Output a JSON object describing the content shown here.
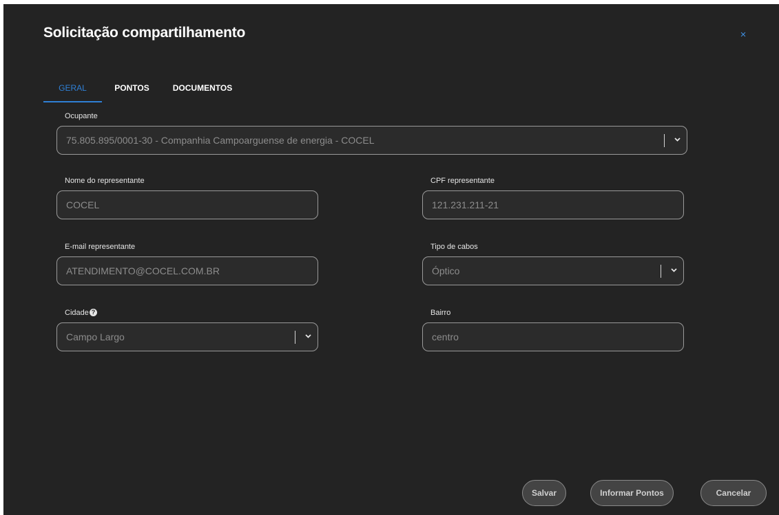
{
  "dialog": {
    "title": "Solicitação compartilhamento",
    "close_label": "×"
  },
  "tabs": [
    {
      "label": "GERAL",
      "active": true
    },
    {
      "label": "PONTOS",
      "active": false
    },
    {
      "label": "DOCUMENTOS",
      "active": false
    }
  ],
  "form": {
    "ocupante": {
      "label": "Ocupante",
      "value": "75.805.895/0001-30 - Companhia Campoarguense de energia - COCEL"
    },
    "nome_representante": {
      "label": "Nome do representante",
      "value": "COCEL"
    },
    "cpf_representante": {
      "label": "CPF representante",
      "value": "121.231.211-21"
    },
    "email_representante": {
      "label": "E-mail representante",
      "value": "ATENDIMENTO@COCEL.COM.BR"
    },
    "tipo_cabos": {
      "label": "Tipo de cabos",
      "value": "Óptico"
    },
    "cidade": {
      "label": "Cidade",
      "help": "?",
      "value": "Campo Largo"
    },
    "bairro": {
      "label": "Bairro",
      "value": "centro"
    }
  },
  "actions": {
    "save_label": "Salvar",
    "points_label": "Informar Pontos",
    "cancel_label": "Cancelar"
  },
  "icons": {
    "close": "close-icon",
    "dropdown": "chevron-down-icon",
    "help": "question-circle-icon"
  },
  "colors": {
    "background": "#232323",
    "accent": "#2f80d6",
    "field_border": "#9a9a9a",
    "button_bg": "#444444"
  }
}
